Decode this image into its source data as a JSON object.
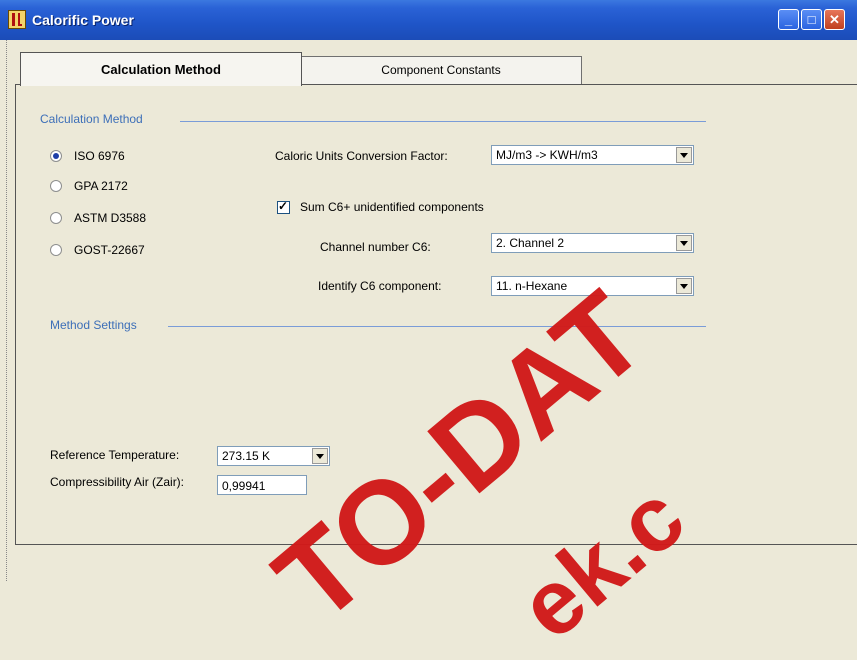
{
  "window": {
    "title": "Calorific Power"
  },
  "tabs": [
    {
      "label": "Calculation Method",
      "active": true
    },
    {
      "label": "Component Constants",
      "active": false
    }
  ],
  "calculation_method": {
    "header": "Calculation Method",
    "options": [
      {
        "label": "ISO 6976",
        "selected": true
      },
      {
        "label": "GPA 2172",
        "selected": false
      },
      {
        "label": "ASTM D3588",
        "selected": false
      },
      {
        "label": "GOST-22667",
        "selected": false
      }
    ],
    "caloric_units_label": "Caloric Units Conversion Factor:",
    "caloric_units_value": "MJ/m3 -> KWH/m3",
    "sum_c6_label": "Sum C6+ unidentified components",
    "sum_c6_checked": true,
    "channel_label": "Channel number C6:",
    "channel_value": "2. Channel 2",
    "identify_label": "Identify C6 component:",
    "identify_value": "11. n-Hexane"
  },
  "method_settings": {
    "header": "Method Settings",
    "ref_temp_label": "Reference Temperature:",
    "ref_temp_value": "273.15 K",
    "compress_label": "Compressibility Air (Zair):",
    "compress_value": "0,99941"
  },
  "watermark": {
    "line1": "TO-DAT",
    "line2": "ek.c"
  },
  "colors": {
    "titlebar": "#2a62d6",
    "group_header": "#3d6fb8",
    "watermark": "#d11a1a"
  }
}
